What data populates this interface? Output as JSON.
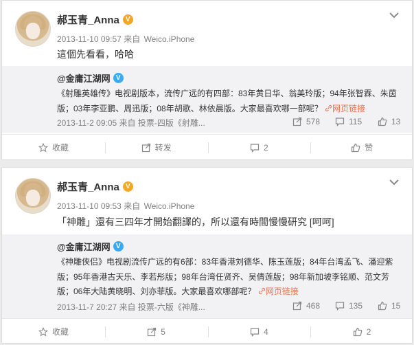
{
  "colors": {
    "background": "#ebebeb",
    "card": "#ffffff",
    "repost_bg": "#f2f2f5",
    "link": "#eb7350",
    "verified_orange": "#f5a623",
    "verified_blue": "#3aaaf5",
    "meta_gray": "#808080"
  },
  "posts": [
    {
      "username": "郝玉青_Anna",
      "timestamp": "2013-11-10 09:57",
      "source_prefix": "来自",
      "source": "Weico.iPhone",
      "text": "這個先看看，哈哈",
      "repost": {
        "username": "@金庸江湖网",
        "text": "《射雕英雄传》电视剧版本，流传广远的有四部：83年黄日华、翁美玲版；94年张智霖、朱茵版；03年李亚鹏、周迅版；08年胡歌、林依晨版。大家最喜欢哪一部呢？",
        "link_label": "网页链接",
        "link_icon": "link-icon",
        "meta": "2013-11-2 09:05 来自 投票-四版《射雕...",
        "reposts": "578",
        "comments": "115",
        "likes": "13"
      },
      "actions": {
        "favorite": "收藏",
        "repost": "转发",
        "comment": "2",
        "like": "赞"
      }
    },
    {
      "username": "郝玉青_Anna",
      "timestamp": "2013-11-10 09:53",
      "source_prefix": "来自",
      "source": "Weico.iPhone",
      "text": "「神雕」還有三四年才開始翻譯的，所以還有時間慢慢研究 [呵呵]",
      "repost": {
        "username": "@金庸江湖网",
        "text": "《神雕侠侣》电视剧流传广远的有6部：83年香港刘德华、陈玉莲版；84年台湾孟飞、潘迎紫版；95年香港古天乐、李若彤版；98年台湾任贤齐、吴倩莲版；98年新加坡李铭顺、范文芳版；06年大陆黄晓明、刘亦菲版。大家最喜欢哪部呢？",
        "link_label": "网页链接",
        "link_icon": "link-icon",
        "meta": "2013-11-7 20:27 来自 投票-六版《神雕...",
        "reposts": "468",
        "comments": "135",
        "likes": "15"
      },
      "actions": {
        "favorite": "收藏",
        "repost": "5",
        "comment": "4",
        "like": "2"
      }
    }
  ],
  "icons": {
    "verified_badge": "V",
    "menu": "chevron-down-icon",
    "favorite": "star-icon",
    "repost": "repost-icon",
    "comment": "comment-icon",
    "like": "thumbs-up-icon"
  }
}
